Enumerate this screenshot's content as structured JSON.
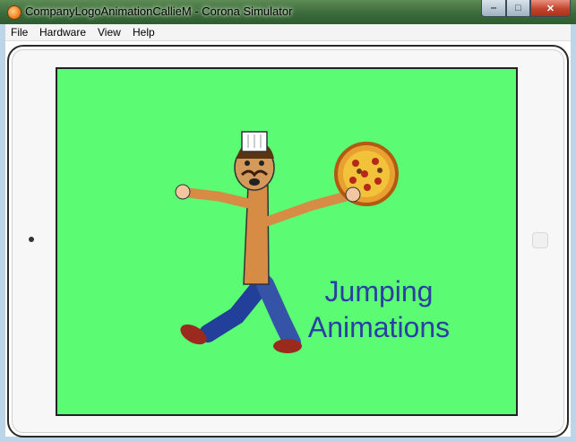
{
  "window": {
    "title": "CompanyLogoAnimationCallieM - Corona Simulator",
    "controls": {
      "minimize": "‒",
      "maximize": "□",
      "close": "✕"
    }
  },
  "menu": [
    "File",
    "Hardware",
    "View",
    "Help"
  ],
  "screen": {
    "background": "#5bfb73",
    "caption_line1": "Jumping",
    "caption_line2": "Animations",
    "caption_color": "#2a3fa3"
  }
}
